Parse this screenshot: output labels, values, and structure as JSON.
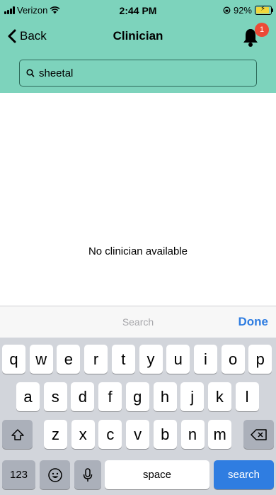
{
  "status_bar": {
    "carrier": "Verizon",
    "time": "2:44 PM",
    "battery_percent": "92%",
    "signal_bars": 4
  },
  "nav": {
    "back_label": "Back",
    "title": "Clinician",
    "notification_count": "1"
  },
  "search": {
    "value": "sheetal",
    "placeholder": ""
  },
  "empty_state": "No clinician available",
  "accessory": {
    "title": "Search",
    "done_label": "Done"
  },
  "keyboard": {
    "row1": [
      "q",
      "w",
      "e",
      "r",
      "t",
      "y",
      "u",
      "i",
      "o",
      "p"
    ],
    "row2": [
      "a",
      "s",
      "d",
      "f",
      "g",
      "h",
      "j",
      "k",
      "l"
    ],
    "row3": [
      "z",
      "x",
      "c",
      "v",
      "b",
      "n",
      "m"
    ],
    "numbers_label": "123",
    "space_label": "space",
    "return_label": "search"
  },
  "colors": {
    "header_bg": "#7dd3bc",
    "badge": "#ec4a37",
    "accent_blue": "#2f7de1"
  }
}
